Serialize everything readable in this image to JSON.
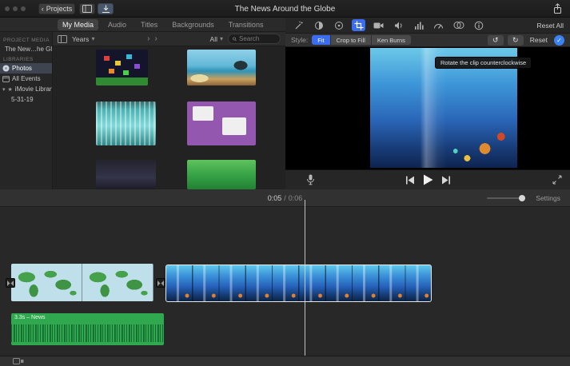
{
  "titlebar": {
    "back_glyph": "‹",
    "projects_label": "Projects",
    "title": "The News Around the Globe"
  },
  "tabs": {
    "my_media": "My Media",
    "audio": "Audio",
    "titles": "Titles",
    "backgrounds": "Backgrounds",
    "transitions": "Transitions"
  },
  "sidebar": {
    "project_media_header": "PROJECT MEDIA",
    "project_name": "The New…he Globe",
    "libraries_header": "LIBRARIES",
    "photos": "Photos",
    "all_events": "All Events",
    "imovie_library": "iMovie Library",
    "event_date": "5-31-19"
  },
  "filter": {
    "years": "Years",
    "all": "All",
    "search_placeholder": "Search"
  },
  "viewer": {
    "reset_all": "Reset All",
    "style_label": "Style:",
    "fit": "Fit",
    "crop_to_fill": "Crop to Fill",
    "ken_burns": "Ken Burns",
    "rotate_ccw_glyph": "↺",
    "rotate_cw_glyph": "↻",
    "reset": "Reset",
    "apply_glyph": "✓",
    "tooltip": "Rotate the clip counterclockwise"
  },
  "timeline": {
    "time_current": "0:05",
    "time_sep": "/",
    "time_total": "0:06",
    "settings": "Settings",
    "audio_clip_label": "3.3s – News"
  },
  "glyphs": {
    "chevron_down": "▾",
    "chevron_right": "›",
    "disclosure_down": "▾",
    "star": "★"
  },
  "colors": {
    "accent_blue": "#3c6df0",
    "selection_border": "#e6e6e6",
    "audio_green": "#2fa84f"
  }
}
